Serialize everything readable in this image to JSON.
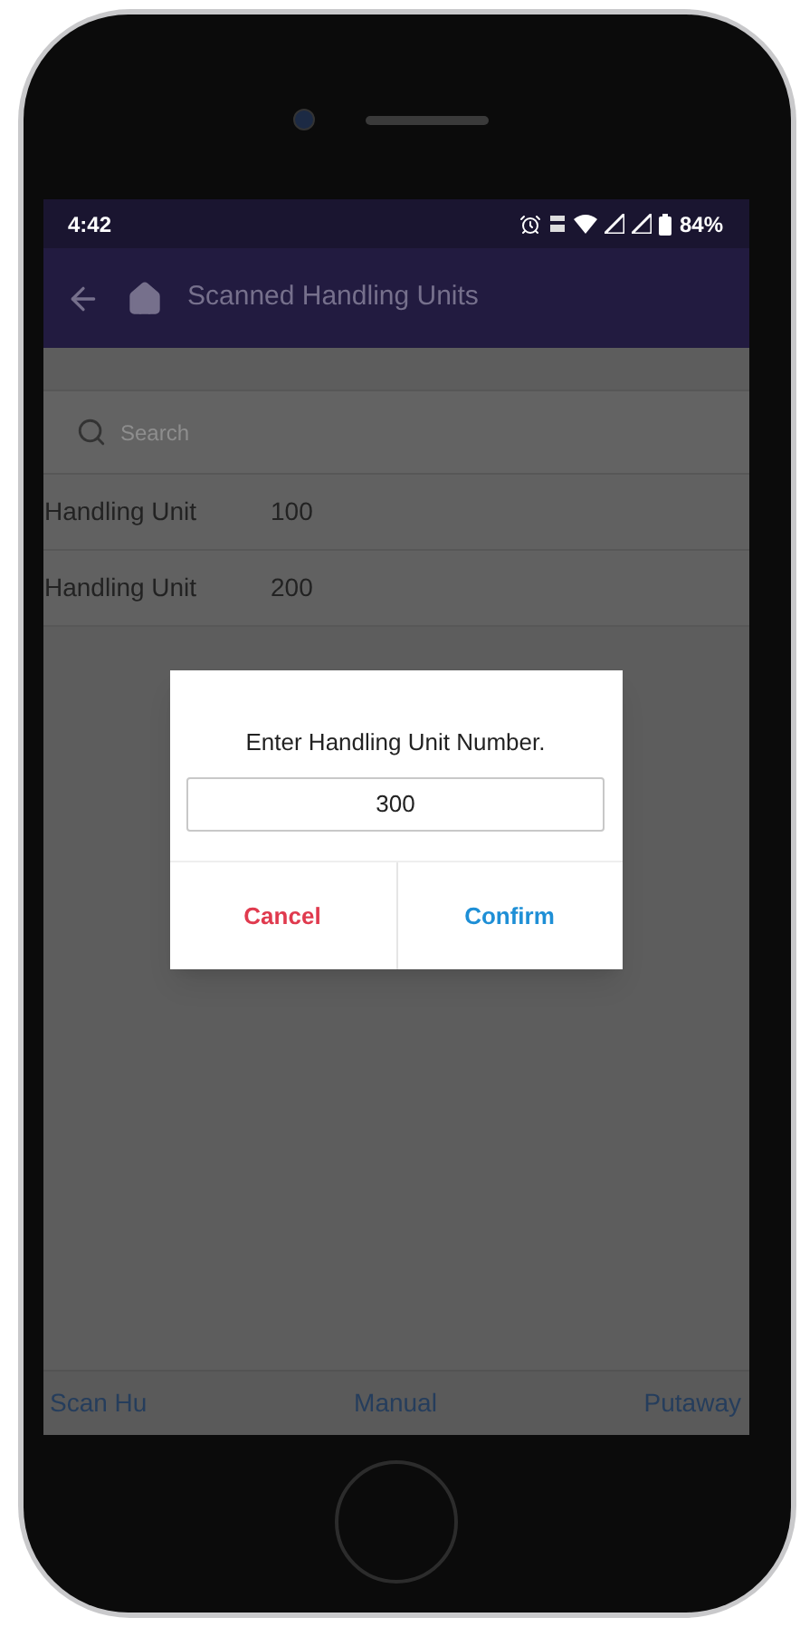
{
  "status_bar": {
    "time": "4:42",
    "battery": "84%"
  },
  "app_bar": {
    "title": "Scanned Handling Units"
  },
  "search": {
    "placeholder": "Search"
  },
  "rows": [
    {
      "label": "Handling Unit",
      "value": "100"
    },
    {
      "label": "Handling Unit",
      "value": "200"
    }
  ],
  "dialog": {
    "title": "Enter Handling Unit Number.",
    "value": "300",
    "buttons": [
      {
        "label": "Cancel",
        "kind": "cancel"
      },
      {
        "label": "Confirm",
        "kind": "confirm"
      }
    ]
  },
  "bottom_nav": [
    {
      "label": "Scan Hu"
    },
    {
      "label": "Manual"
    },
    {
      "label": "Putaway"
    }
  ]
}
